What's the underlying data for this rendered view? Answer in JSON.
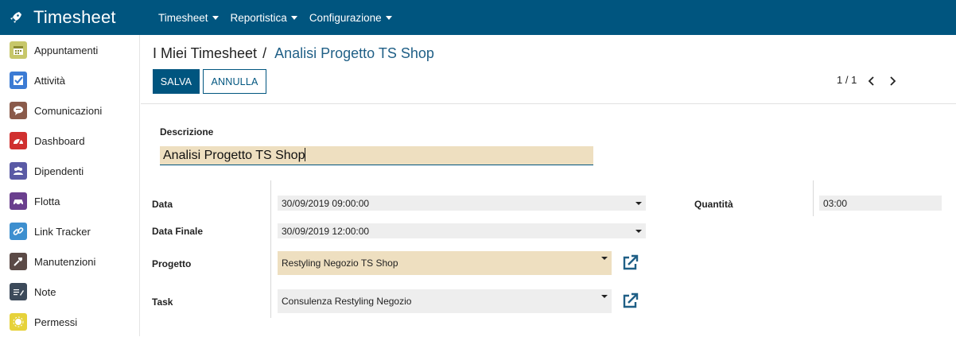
{
  "app": {
    "title": "Timesheet",
    "brand_icon": "rocket-icon"
  },
  "topmenu": [
    {
      "label": "Timesheet"
    },
    {
      "label": "Reportistica"
    },
    {
      "label": "Configurazione"
    }
  ],
  "sidebar": {
    "items": [
      {
        "label": "Appuntamenti",
        "icon": "calendar-icon",
        "color": "#c7c76a"
      },
      {
        "label": "Attività",
        "icon": "checkmark-icon",
        "color": "#3b7bd4"
      },
      {
        "label": "Comunicazioni",
        "icon": "chat-bubble-icon",
        "color": "#8a5a4a"
      },
      {
        "label": "Dashboard",
        "icon": "gauge-icon",
        "color": "#d0302f"
      },
      {
        "label": "Dipendenti",
        "icon": "people-icon",
        "color": "#5a5aa5"
      },
      {
        "label": "Flotta",
        "icon": "car-icon",
        "color": "#6a3f8e"
      },
      {
        "label": "Link Tracker",
        "icon": "link-icon",
        "color": "#3d8fcf"
      },
      {
        "label": "Manutenzioni",
        "icon": "hammer-icon",
        "color": "#5b4a46"
      },
      {
        "label": "Note",
        "icon": "note-pencil-icon",
        "color": "#3c4a5a"
      },
      {
        "label": "Permessi",
        "icon": "sun-icon",
        "color": "#e6d23a"
      }
    ]
  },
  "breadcrumb": {
    "root": "I Miei Timesheet",
    "separator": "/",
    "current": "Analisi Progetto TS Shop"
  },
  "toolbar": {
    "save_label": "SALVA",
    "cancel_label": "ANNULLA"
  },
  "pager": {
    "text": "1 / 1"
  },
  "form": {
    "description_label": "Descrizione",
    "description_value": "Analisi Progetto TS Shop",
    "data_label": "Data",
    "data_value": "30/09/2019 09:00:00",
    "data_finale_label": "Data Finale",
    "data_finale_value": "30/09/2019 12:00:00",
    "progetto_label": "Progetto",
    "progetto_value": "Restyling Negozio TS Shop",
    "task_label": "Task",
    "task_value": "Consulenza Restyling Negozio",
    "quantita_label": "Quantità",
    "quantita_value": "03:00"
  },
  "colors": {
    "accent": "#00557f",
    "required_field": "#eedfc0",
    "link": "#1f5f86"
  }
}
